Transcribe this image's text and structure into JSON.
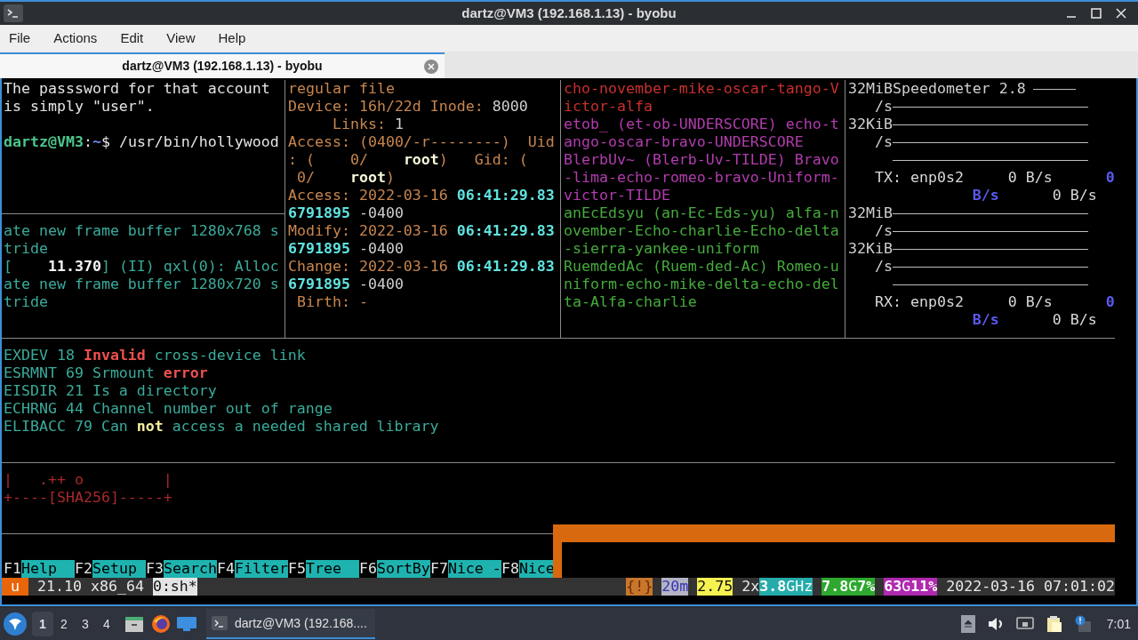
{
  "window": {
    "title": "dartz@VM3 (192.168.1.13) - byobu"
  },
  "menu": [
    {
      "label": "File"
    },
    {
      "label": "Actions"
    },
    {
      "label": "Edit"
    },
    {
      "label": "View"
    },
    {
      "label": "Help"
    }
  ],
  "tabs": [
    {
      "label": "dartz@VM3 (192.168.1.13) - byobu",
      "selected": true
    }
  ],
  "terminal": {
    "log_pane": {
      "top": [
        {
          "segments": [
            {
              "text": "The passsword for that account",
              "kind": "plain"
            }
          ]
        },
        {
          "segments": [
            {
              "text": "is simply \"user\".",
              "kind": "plain"
            }
          ]
        }
      ],
      "prompt": {
        "segments": [
          {
            "text": "dartz@VM3",
            "kind": "prompt"
          },
          {
            "text": ":",
            "kind": "plain"
          },
          {
            "text": "~",
            "kind": "path"
          },
          {
            "text": "$ /usr/bin/hollywood",
            "kind": "plain"
          }
        ]
      },
      "bottom": [
        {
          "segments": [
            {
              "text": "ate new frame buffer 1280x768 s",
              "kind": "log"
            }
          ]
        },
        {
          "segments": [
            {
              "text": "tride",
              "kind": "log"
            }
          ]
        },
        {
          "segments": [
            {
              "text": "[    ",
              "kind": "log"
            },
            {
              "text": "11.370",
              "kind": "strong"
            },
            {
              "text": "] (II) qxl(0): Alloc",
              "kind": "log"
            }
          ]
        },
        {
          "segments": [
            {
              "text": "ate new frame buffer 1280x720 s",
              "kind": "log"
            }
          ]
        },
        {
          "segments": [
            {
              "text": "tride",
              "kind": "log"
            }
          ]
        }
      ]
    },
    "stat_pane": [
      {
        "segments": [
          {
            "text": "regular file",
            "kind": "stat"
          }
        ]
      },
      {
        "segments": [
          {
            "text": "Device: 16h/22d Inode: ",
            "kind": "stat"
          },
          {
            "text": "8000",
            "kind": "dim"
          }
        ]
      },
      {
        "segments": [
          {
            "text": "     Links: ",
            "kind": "stat"
          },
          {
            "text": "1",
            "kind": "dim"
          }
        ]
      },
      {
        "segments": [
          {
            "text": "Access: (0400/-r--------)  Uid",
            "kind": "stat"
          }
        ]
      },
      {
        "segments": [
          {
            "text": ": (    0/    ",
            "kind": "stat"
          },
          {
            "text": "root",
            "kind": "owner"
          },
          {
            "text": ")   Gid: (",
            "kind": "stat"
          }
        ]
      },
      {
        "segments": [
          {
            "text": " 0/    ",
            "kind": "stat"
          },
          {
            "text": "root",
            "kind": "owner"
          },
          {
            "text": ")",
            "kind": "stat"
          }
        ]
      },
      {
        "segments": [
          {
            "text": "Access: 2022-03-16 ",
            "kind": "stat"
          },
          {
            "text": "06:41:29.83",
            "kind": "time"
          }
        ]
      },
      {
        "segments": [
          {
            "text": "6791895",
            "kind": "time"
          },
          {
            "text": " -0400",
            "kind": "dim"
          }
        ]
      },
      {
        "segments": [
          {
            "text": "Modify: 2022-03-16 ",
            "kind": "stat"
          },
          {
            "text": "06:41:29.83",
            "kind": "time"
          }
        ]
      },
      {
        "segments": [
          {
            "text": "6791895",
            "kind": "time"
          },
          {
            "text": " -0400",
            "kind": "dim"
          }
        ]
      },
      {
        "segments": [
          {
            "text": "Change: 2022-03-16 ",
            "kind": "stat"
          },
          {
            "text": "06:41:29.83",
            "kind": "time"
          }
        ]
      },
      {
        "segments": [
          {
            "text": "6791895",
            "kind": "time"
          },
          {
            "text": " -0400",
            "kind": "dim"
          }
        ]
      },
      {
        "segments": [
          {
            "text": " Birth: -",
            "kind": "stat"
          }
        ]
      }
    ],
    "words_pane": [
      {
        "segments": [
          {
            "text": "cho-november-mike-oscar-tango-V",
            "kind": "red"
          }
        ]
      },
      {
        "segments": [
          {
            "text": "ictor-alfa",
            "kind": "red"
          }
        ]
      },
      {
        "segments": [
          {
            "text": "etob_ (et-ob-UNDERSCORE) echo-t",
            "kind": "magenta"
          }
        ]
      },
      {
        "segments": [
          {
            "text": "ango-oscar-bravo-UNDERSCORE",
            "kind": "magenta"
          }
        ]
      },
      {
        "segments": [
          {
            "text": "BlerbUv~ (Blerb-Uv-TILDE) Bravo",
            "kind": "magenta"
          }
        ]
      },
      {
        "segments": [
          {
            "text": "-lima-echo-romeo-bravo-Uniform-",
            "kind": "magenta"
          }
        ]
      },
      {
        "segments": [
          {
            "text": "victor-TILDE",
            "kind": "magenta"
          }
        ]
      },
      {
        "segments": [
          {
            "text": "anEcEdsyu (an-Ec-Eds-yu) alfa-n",
            "kind": "green"
          }
        ]
      },
      {
        "segments": [
          {
            "text": "ovember-Echo-charlie-Echo-delta",
            "kind": "green"
          }
        ]
      },
      {
        "segments": [
          {
            "text": "-sierra-yankee-uniform",
            "kind": "green"
          }
        ]
      },
      {
        "segments": [
          {
            "text": "RuemdedAc (Ruem-ded-Ac) Romeo-u",
            "kind": "green"
          }
        ]
      },
      {
        "segments": [
          {
            "text": "niform-echo-mike-delta-echo-del",
            "kind": "green"
          }
        ]
      },
      {
        "segments": [
          {
            "text": "ta-Alfa-charlie",
            "kind": "green"
          }
        ]
      }
    ],
    "speed_pane": [
      {
        "kind": "title",
        "label": "32MiBSpeedometer 2.8"
      },
      {
        "kind": "graph",
        "label": "/s"
      },
      {
        "kind": "graph",
        "label": "32KiB"
      },
      {
        "kind": "graph",
        "label": "/s"
      },
      {
        "kind": "graph"
      },
      {
        "kind": "text",
        "segments": [
          {
            "text": "   TX: enp0s2     0 B/s      ",
            "kind": "traffic"
          },
          {
            "text": "0",
            "kind": "rate"
          }
        ]
      },
      {
        "kind": "text",
        "segments": [
          {
            "text": "              B/s",
            "kind": "rate"
          },
          {
            "text": "      0 B/s",
            "kind": "traffic"
          }
        ]
      },
      {
        "kind": "graph",
        "label": "32MiB"
      },
      {
        "kind": "graph",
        "label": "/s"
      },
      {
        "kind": "graph",
        "label": "32KiB"
      },
      {
        "kind": "graph",
        "label": "/s"
      },
      {
        "kind": "graph"
      },
      {
        "kind": "text",
        "segments": [
          {
            "text": "   RX: enp0s2     0 B/s      ",
            "kind": "traffic"
          },
          {
            "text": "0",
            "kind": "rate"
          }
        ]
      },
      {
        "kind": "text",
        "segments": [
          {
            "text": "              B/s",
            "kind": "rate"
          },
          {
            "text": "      0 B/s",
            "kind": "traffic"
          }
        ]
      }
    ],
    "errors": [
      {
        "segments": [
          {
            "text": "EXDEV 18 ",
            "kind": "log"
          },
          {
            "text": "Invalid",
            "kind": "error_word"
          },
          {
            "text": " cross-device link",
            "kind": "log"
          }
        ]
      },
      {
        "segments": [
          {
            "text": "ESRMNT 69 Srmount ",
            "kind": "log"
          },
          {
            "text": "error",
            "kind": "error_word"
          }
        ]
      },
      {
        "segments": [
          {
            "text": "EISDIR 21 Is a directory",
            "kind": "log"
          }
        ]
      },
      {
        "segments": [
          {
            "text": "ECHRNG 44 Channel number out of range",
            "kind": "log"
          }
        ]
      },
      {
        "segments": [
          {
            "text": "ELIBACC 79 Can ",
            "kind": "log"
          },
          {
            "text": "not",
            "kind": "negation"
          },
          {
            "text": " access a needed shared library",
            "kind": "log"
          }
        ]
      }
    ],
    "art": [
      {
        "segments": [
          {
            "text": "|   .++ o         |",
            "kind": "art"
          }
        ]
      },
      {
        "segments": [
          {
            "text": "+----[SHA256]-----+",
            "kind": "art"
          }
        ]
      }
    ],
    "fkeys": [
      {
        "key": "F1",
        "label": "Help"
      },
      {
        "key": "F2",
        "label": "Setup"
      },
      {
        "key": "F3",
        "label": "Search"
      },
      {
        "key": "F4",
        "label": "Filter"
      },
      {
        "key": "F5",
        "label": "Tree"
      },
      {
        "key": "F6",
        "label": "SortBy"
      },
      {
        "key": "F7",
        "label": "Nice -"
      },
      {
        "key": "F8",
        "label": "Nice"
      }
    ],
    "status_left": [
      {
        "text": "u",
        "kind": "user"
      },
      {
        "text": "21.10 x86_64",
        "kind": "release"
      },
      {
        "text": "0:sh*",
        "kind": "window"
      }
    ],
    "status_right": [
      {
        "text": "{!}",
        "kind": "alert"
      },
      {
        "text": "20m",
        "kind": "uptime"
      },
      {
        "text": "2.75",
        "kind": "load"
      },
      {
        "text": "2x",
        "kind": "cores"
      },
      {
        "text": "**3.8**GHz",
        "kind": "freq"
      },
      {
        "text": "**7.8**G**7%**",
        "kind": "memory"
      },
      {
        "text": "**63**G**11%**",
        "kind": "disk"
      },
      {
        "text": "2022-03-16 07:01:02",
        "kind": "clock"
      }
    ]
  },
  "taskbar": {
    "workspaces": [
      {
        "label": "1",
        "selected": true
      },
      {
        "label": "2",
        "selected": false
      },
      {
        "label": "3",
        "selected": false
      },
      {
        "label": "4",
        "selected": false
      }
    ],
    "task": {
      "label": "dartz@VM3 (192.168....",
      "selected": true
    },
    "clock": "7:01"
  }
}
